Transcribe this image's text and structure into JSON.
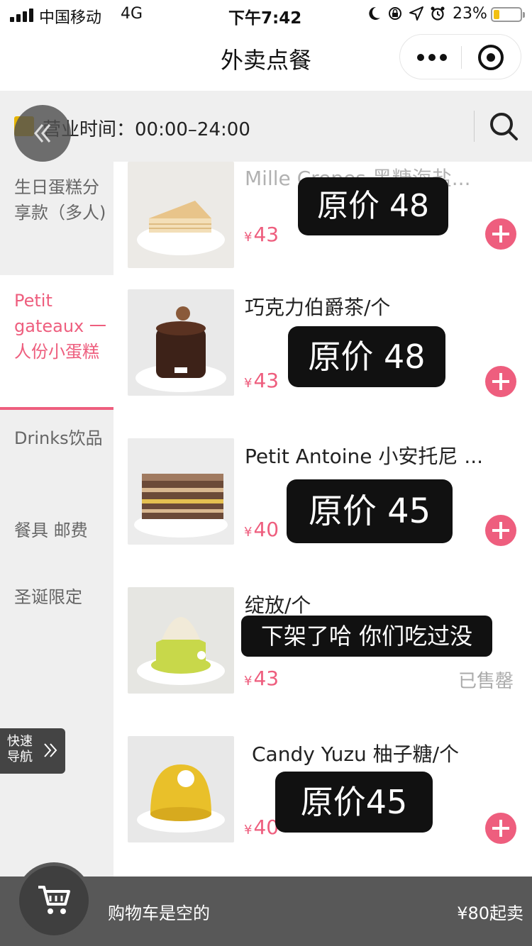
{
  "status_bar": {
    "carrier": "中国移动",
    "network": "4G",
    "time": "下午7:42",
    "battery_pct": "23%",
    "battery_level": 0.23
  },
  "nav": {
    "title": "外卖点餐"
  },
  "hours": {
    "text": "营业时间：00:00–24:00"
  },
  "sidebar": {
    "categories": [
      {
        "label": "生日蛋糕分享款（多人)"
      },
      {
        "label": "Petit gateaux 一人份小蛋糕"
      },
      {
        "label": "Drinks饮品"
      },
      {
        "label": "餐具 邮费"
      },
      {
        "label": "圣诞限定"
      }
    ],
    "quick_nav": "快速导航"
  },
  "products": [
    {
      "name": "Mille Crepes 黑糖海盐...",
      "currency": "¥",
      "price": "43",
      "overlay": "原价 48",
      "colors": {
        "top": "#e8c48a",
        "body": "#f3dfb8"
      }
    },
    {
      "name": "巧克力伯爵茶/个",
      "currency": "¥",
      "price": "43",
      "overlay": "原价 48",
      "colors": {
        "top": "#5a3221",
        "body": "#3d2218"
      }
    },
    {
      "name": "Petit Antoine 小安托尼 ...",
      "currency": "¥",
      "price": "40",
      "overlay": "原价 45",
      "colors": {
        "top": "#a07a60",
        "body": "#6b4a38"
      }
    },
    {
      "name": "绽放/个",
      "currency": "¥",
      "price": "43",
      "overlay": "下架了哈 你们吃过没",
      "status": "已售罄",
      "colors": {
        "top": "#f1ead8",
        "body": "#c8d84a"
      }
    },
    {
      "name": "Candy Yuzu 柚子糖/个",
      "currency": "¥",
      "price": "40",
      "overlay": "原价45",
      "colors": {
        "top": "#f5d24a",
        "body": "#e9c02a"
      }
    }
  ],
  "cart": {
    "empty_text": "购物车是空的",
    "min_order": "¥80起卖"
  },
  "colors": {
    "accent": "#ee5e7e",
    "cart_bar": "#585858"
  }
}
